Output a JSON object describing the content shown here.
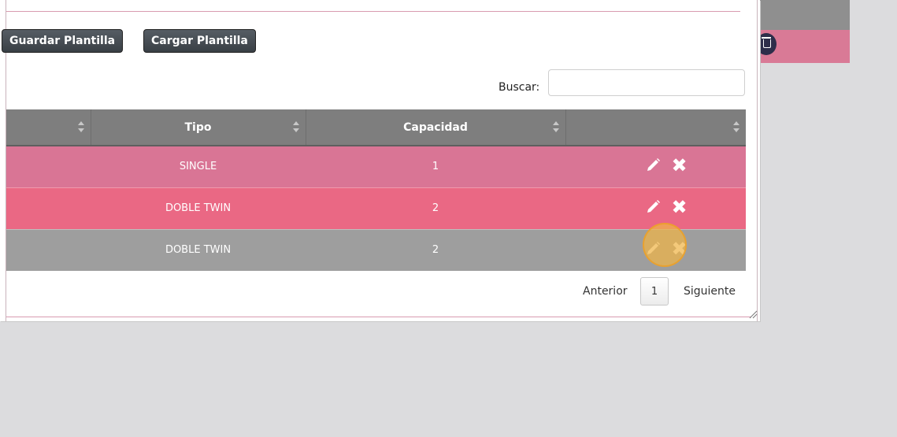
{
  "toolbar": {
    "save_template_label": "Guardar Plantilla",
    "load_template_label": "Cargar Plantilla"
  },
  "search": {
    "label": "Buscar:",
    "value": "",
    "placeholder": ""
  },
  "table": {
    "columns": [
      "",
      "Tipo",
      "Capacidad",
      ""
    ],
    "rows": [
      {
        "tipo": "SINGLE",
        "capacidad": "1",
        "color": "#d97595"
      },
      {
        "tipo": "DOBLE TWIN",
        "capacidad": "2",
        "color": "#ea6884"
      },
      {
        "tipo": "DOBLE TWIN",
        "capacidad": "2",
        "color": "#9e9e9e"
      }
    ],
    "row_icons": [
      "edit-icon",
      "close-icon"
    ]
  },
  "pagination": {
    "previous_label": "Anterior",
    "current_page": "1",
    "next_label": "Siguiente"
  },
  "colors": {
    "header_bg": "#7e7e7e",
    "button_bg": "#393f45",
    "background": "#dcdcde",
    "accent_line": "#d99bb0"
  }
}
